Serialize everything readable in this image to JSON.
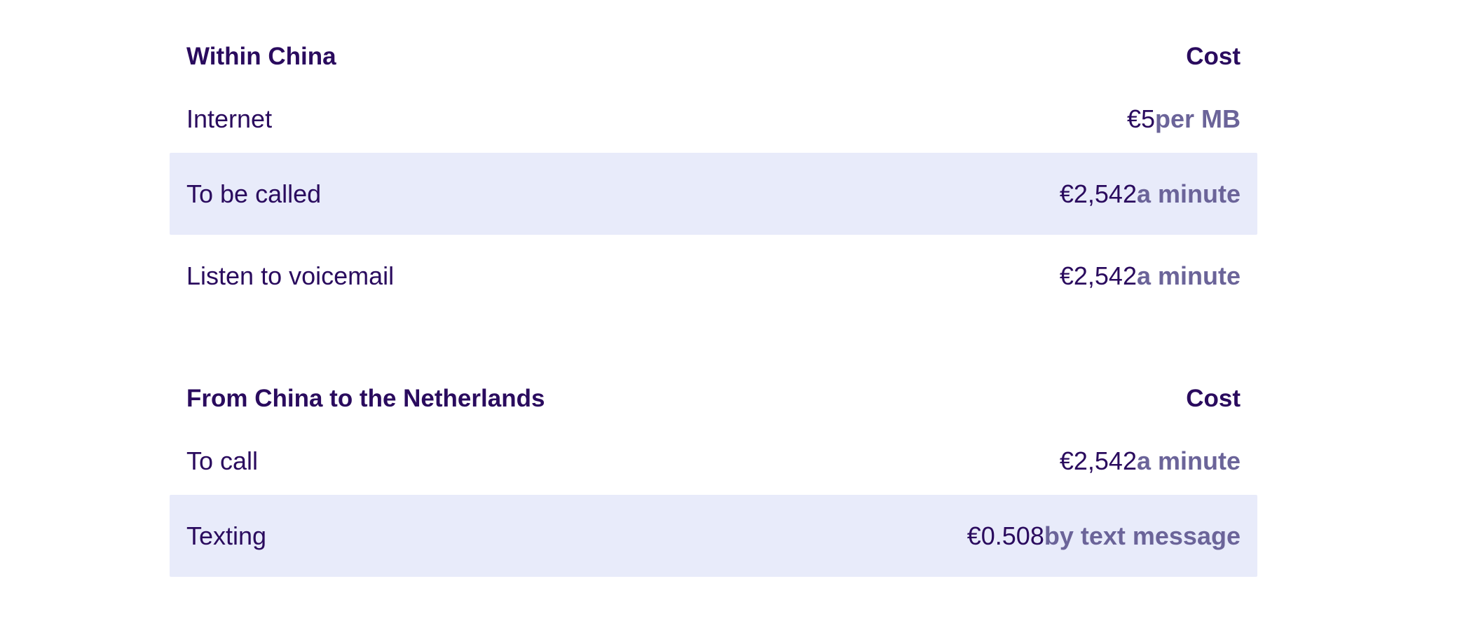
{
  "tables": [
    {
      "heading": "Within China",
      "cost_heading": "Cost",
      "rows": [
        {
          "label": "Internet",
          "amount": "€5",
          "unit": "per MB"
        },
        {
          "label": "To be called",
          "amount": "€2,542",
          "unit": "a minute"
        },
        {
          "label": "Listen to voicemail",
          "amount": "€2,542",
          "unit": "a minute"
        }
      ]
    },
    {
      "heading": "From China to the Netherlands",
      "cost_heading": "Cost",
      "rows": [
        {
          "label": "To call",
          "amount": "€2,542",
          "unit": "a minute"
        },
        {
          "label": "Texting",
          "amount": "€0.508",
          "unit": "by text message"
        }
      ]
    }
  ],
  "colors": {
    "text": "#2a0b5e",
    "unit": "#6b6499",
    "row_shade": "#e8ebfa"
  }
}
